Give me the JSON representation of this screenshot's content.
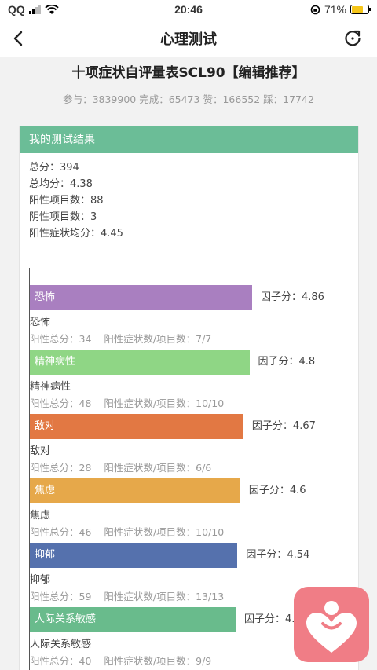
{
  "status_bar": {
    "carrier": "QQ",
    "time": "20:46",
    "battery": "71%",
    "battery_level": 0.71,
    "icons": [
      "signal-icon",
      "wifi-icon",
      "rotation-lock-icon",
      "battery-icon"
    ]
  },
  "nav": {
    "title": "心理测试",
    "back_icon": "chevron-left-icon",
    "refresh_icon": "refresh-icon"
  },
  "test": {
    "title": "十项症状自评量表SCL90【编辑推荐】",
    "stats": "参与：3839900 完成：65473 赞：166552 踩：17742"
  },
  "result": {
    "header": "我的测试结果",
    "summary": [
      "总分：394",
      "总均分：4.38",
      "阳性项目数：88",
      "阴性项目数：3",
      "阳性症状均分：4.45"
    ]
  },
  "chart_data": {
    "type": "bar",
    "orientation": "horizontal",
    "xlim": [
      0,
      5
    ],
    "factors": [
      {
        "label": "恐怖",
        "value": 4.86,
        "score_text": "因子分：4.86",
        "name": "恐怖",
        "total": "阳性总分：34",
        "ratio": "阳性症状数/项目数：7/7",
        "color": "#a97fc0"
      },
      {
        "label": "精神病性",
        "value": 4.8,
        "score_text": "因子分：4.8",
        "name": "精神病性",
        "total": "阳性总分：48",
        "ratio": "阳性症状数/项目数：10/10",
        "color": "#8fd685"
      },
      {
        "label": "敌对",
        "value": 4.67,
        "score_text": "因子分：4.67",
        "name": "敌对",
        "total": "阳性总分：28",
        "ratio": "阳性症状数/项目数：6/6",
        "color": "#e27843"
      },
      {
        "label": "焦虑",
        "value": 4.6,
        "score_text": "因子分：4.6",
        "name": "焦虑",
        "total": "阳性总分：46",
        "ratio": "阳性症状数/项目数：10/10",
        "color": "#e6a84a"
      },
      {
        "label": "抑郁",
        "value": 4.54,
        "score_text": "因子分：4.54",
        "name": "抑郁",
        "total": "阳性总分：59",
        "ratio": "阳性症状数/项目数：13/13",
        "color": "#5571ad"
      },
      {
        "label": "人际关系敏感",
        "value": 4.5,
        "score_text": "因子分：4.5",
        "name": "人际关系敏感",
        "total": "阳性总分：40",
        "ratio": "阳性症状数/项目数：9/9",
        "color": "#69bb8c"
      }
    ]
  },
  "colors": {
    "header_green": "#6bbd97",
    "logo_pink": "#f07d86"
  }
}
